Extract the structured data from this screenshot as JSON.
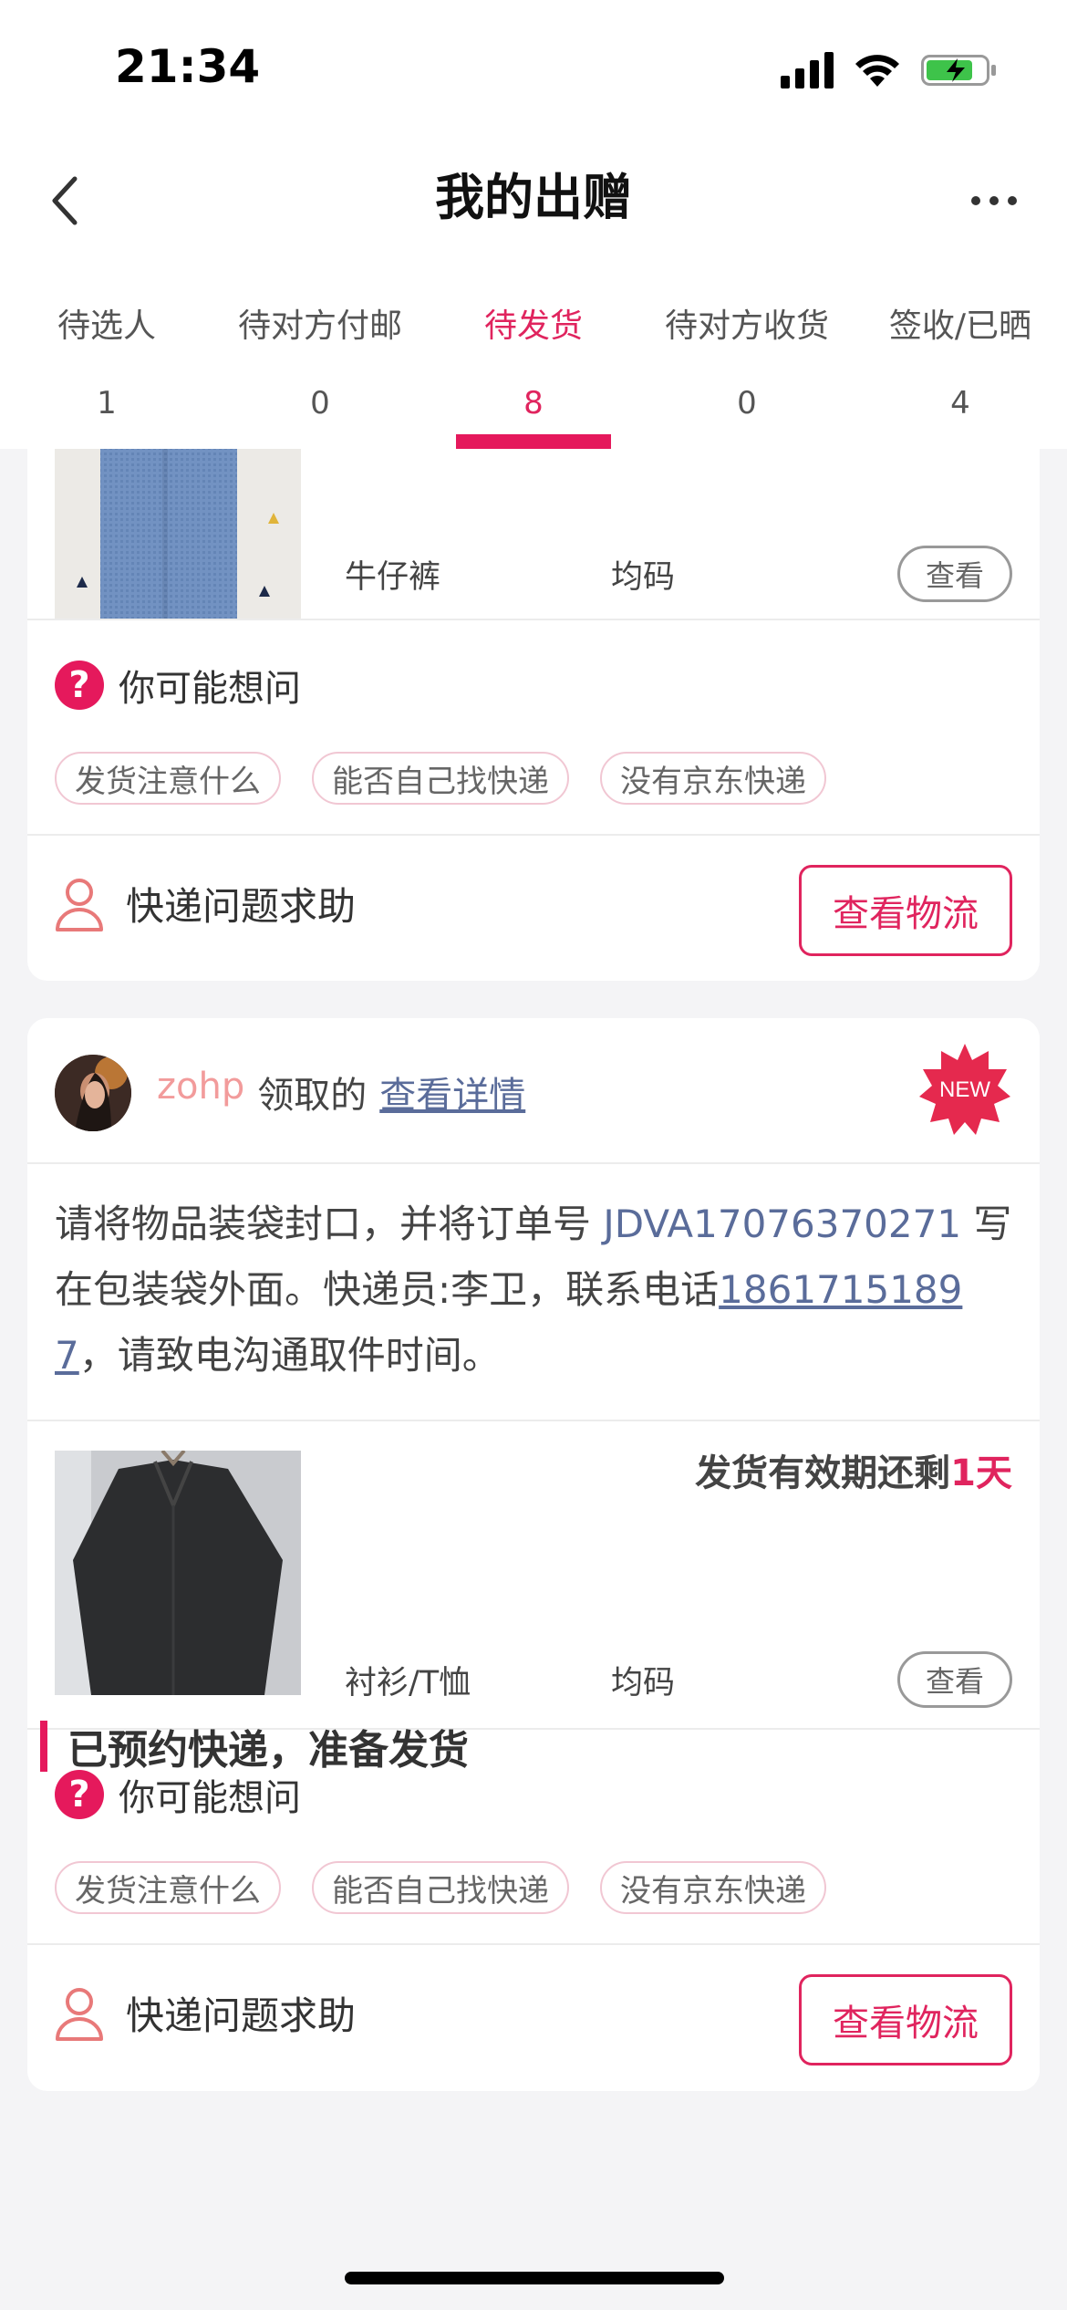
{
  "status_bar": {
    "time": "21:34"
  },
  "nav": {
    "title": "我的出赠"
  },
  "tabs": [
    {
      "label": "待选人",
      "count": "1"
    },
    {
      "label": "待对方付邮",
      "count": "0"
    },
    {
      "label": "待发货",
      "count": "8",
      "active": true
    },
    {
      "label": "待对方收货",
      "count": "0"
    },
    {
      "label": "签收/已晒",
      "count": "4"
    }
  ],
  "card1": {
    "item": {
      "name": "牛仔裤",
      "size": "均码",
      "view_label": "查看"
    },
    "faq": {
      "title": "你可能想问",
      "chips": [
        "发货注意什么",
        "能否自己找快递",
        "没有京东快递"
      ]
    },
    "help": {
      "label": "快递问题求助",
      "logistics_label": "查看物流"
    }
  },
  "card2": {
    "claimer": "zohp",
    "claim_text": "领取的",
    "detail_link": "查看详情",
    "new_badge": "NEW",
    "instructions": {
      "part1": "请将物品装袋封口，并将订单号 ",
      "order_no": "JDVA17076370271",
      "part2": " 写在包装袋外面。快递员:李卫，联系电话",
      "phone": "18617151897",
      "part3": "，请致电沟通取件时间。"
    },
    "deadline": {
      "prefix": "发货有效期还剩",
      "days": "1天"
    },
    "item": {
      "name": "衬衫/T恤",
      "size": "均码",
      "view_label": "查看"
    },
    "faq": {
      "title": "你可能想问",
      "chips": [
        "发货注意什么",
        "能否自己找快递",
        "没有京东快递"
      ]
    },
    "help": {
      "label": "快递问题求助",
      "logistics_label": "查看物流"
    }
  },
  "section": {
    "heading": "已预约快递，准备发货"
  },
  "colors": {
    "accent": "#e5195c",
    "link": "#5a6c9a",
    "claimer": "#f29b9b"
  }
}
